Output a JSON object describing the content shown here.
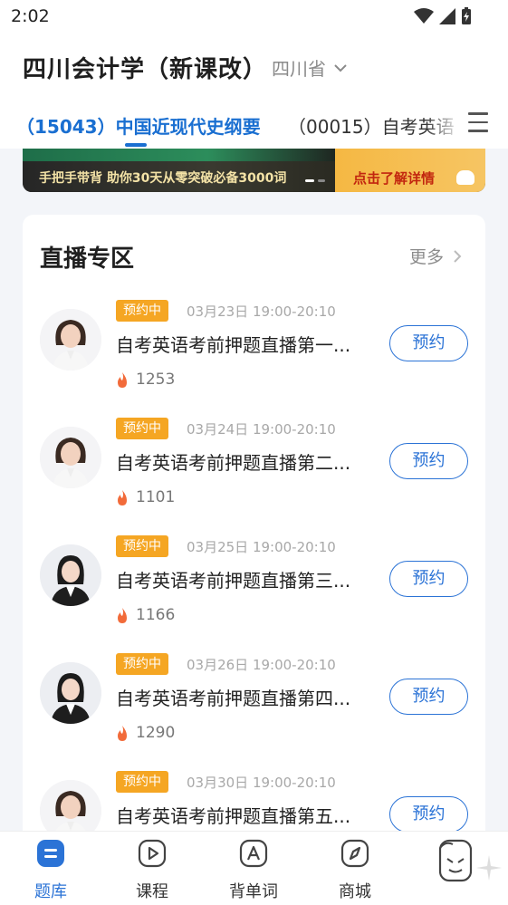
{
  "status": {
    "time": "2:02"
  },
  "header": {
    "title": "四川会计学（新课改）",
    "province": "四川省"
  },
  "tabs": [
    {
      "label": "（15043）中国近现代史纲要",
      "active": true
    },
    {
      "label": "（00015）自考英语",
      "active": false
    }
  ],
  "banner": {
    "text": "手把手带背 助你30天从零突破必备3000词",
    "cta": "点击了解详情"
  },
  "live": {
    "title": "直播专区",
    "more": "更多",
    "items": [
      {
        "badge": "预约中",
        "time": "03月23日 19:00-20:10",
        "title": "自考英语考前押题直播第一...",
        "heat": "1253",
        "action": "预约"
      },
      {
        "badge": "预约中",
        "time": "03月24日 19:00-20:10",
        "title": "自考英语考前押题直播第二...",
        "heat": "1101",
        "action": "预约"
      },
      {
        "badge": "预约中",
        "time": "03月25日 19:00-20:10",
        "title": "自考英语考前押题直播第三...",
        "heat": "1166",
        "action": "预约"
      },
      {
        "badge": "预约中",
        "time": "03月26日 19:00-20:10",
        "title": "自考英语考前押题直播第四...",
        "heat": "1290",
        "action": "预约"
      },
      {
        "badge": "预约中",
        "time": "03月30日 19:00-20:10",
        "title": "自考英语考前押题直播第五...",
        "heat": "",
        "action": "预约"
      }
    ]
  },
  "nav": [
    {
      "label": "题库",
      "icon": "question-bank-icon",
      "active": true
    },
    {
      "label": "课程",
      "icon": "play-course-icon",
      "active": false
    },
    {
      "label": "背单词",
      "icon": "word-a-icon",
      "active": false
    },
    {
      "label": "商城",
      "icon": "compass-store-icon",
      "active": false
    }
  ],
  "colors": {
    "accent": "#2b73d6",
    "badge": "#f5a623",
    "flame": "#f26b3a"
  }
}
